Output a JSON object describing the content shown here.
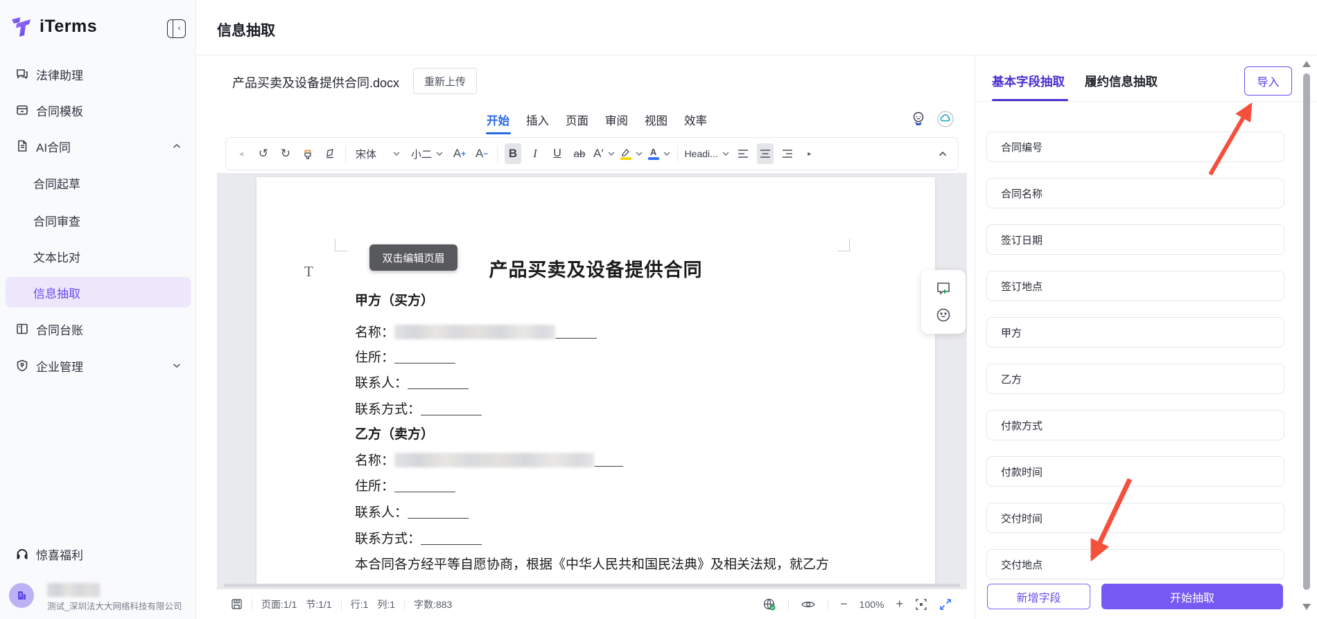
{
  "sidebar": {
    "brand": "iTerms",
    "nav": [
      {
        "label": "法律助理"
      },
      {
        "label": "合同模板"
      },
      {
        "label": "AI合同"
      },
      {
        "label": "合同起草"
      },
      {
        "label": "合同审查"
      },
      {
        "label": "文本比对"
      },
      {
        "label": "信息抽取"
      },
      {
        "label": "合同台账"
      },
      {
        "label": "企业管理"
      }
    ],
    "benefits": "惊喜福利",
    "company": "测试_深圳法大大网络科技有限公司"
  },
  "header": {
    "title": "信息抽取"
  },
  "file": {
    "name": "产品买卖及设备提供合同.docx",
    "reupload": "重新上传"
  },
  "editor": {
    "tabs": [
      "开始",
      "插入",
      "页面",
      "审阅",
      "视图",
      "效率"
    ],
    "toolbar": {
      "font": "宋体",
      "size": "小二",
      "grow": "A",
      "shrink": "A",
      "bold": "B",
      "italic": "I",
      "underline": "U",
      "strike": "ab",
      "script": "A′",
      "color_letter": "A",
      "heading": "Headi..."
    },
    "doc": {
      "header_tip": "双击编辑页眉",
      "cursor_mark": "T",
      "title": "产品买卖及设备提供合同",
      "sections": [
        {
          "heading": "甲方（买方）",
          "rows": [
            {
              "label": "名称："
            },
            {
              "label": "住所："
            },
            {
              "label": "联系人："
            },
            {
              "label": "联系方式："
            }
          ]
        },
        {
          "heading": "乙方（卖方）",
          "rows": [
            {
              "label": "名称："
            },
            {
              "label": "住所："
            },
            {
              "label": "联系人："
            },
            {
              "label": "联系方式："
            }
          ]
        }
      ],
      "closing": "本合同各方经平等自愿协商，根据《中华人民共和国民法典》及相关法规，就乙方"
    },
    "status": {
      "page": "页面:1/1",
      "section": "节:1/1",
      "line": "行:1",
      "column": "列:1",
      "words": "字数:883",
      "zoom": "100%"
    }
  },
  "panel": {
    "tabs": [
      {
        "label": "基本字段抽取"
      },
      {
        "label": "履约信息抽取"
      }
    ],
    "import": "导入",
    "fields": [
      "合同编号",
      "合同名称",
      "签订日期",
      "签订地点",
      "甲方",
      "乙方",
      "付款方式",
      "付款时间",
      "交付时间",
      "交付地点"
    ],
    "add_field": "新增字段",
    "start_extract": "开始抽取"
  },
  "colors": {
    "accent_purple": "#6C4CF1",
    "tab_blue": "#2968E3",
    "arrow_red": "#F4503C"
  }
}
